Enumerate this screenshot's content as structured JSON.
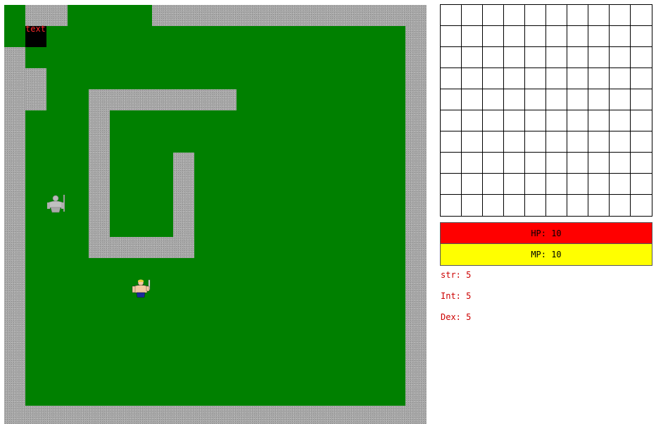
{
  "map": {
    "floor_color": "#008000",
    "wall_color": "#a8a8a8",
    "tile_label": "text",
    "entities": [
      {
        "name": "statue-enemy-icon",
        "kind": "stone-warrior"
      },
      {
        "name": "player-icon",
        "kind": "barbarian-hero"
      }
    ]
  },
  "hud": {
    "hp": {
      "label": "HP: 10",
      "color": "#ff0000",
      "value": 10
    },
    "mp": {
      "label": "MP: 10",
      "color": "#ffff00",
      "value": 10
    }
  },
  "stats": {
    "str": "str: 5",
    "int": "Int: 5",
    "dex": "Dex: 5"
  },
  "inventory": {
    "rows": 10,
    "cols": 10
  }
}
